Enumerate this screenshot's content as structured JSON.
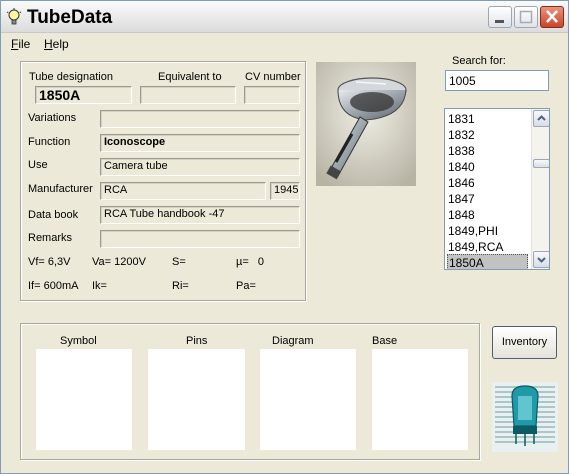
{
  "app": {
    "title": "TubeData"
  },
  "window_controls": {
    "minimize": "minimize",
    "maximize": "maximize",
    "close": "close"
  },
  "menu": [
    {
      "label": "File"
    },
    {
      "label": "Help"
    }
  ],
  "details": {
    "tube_designation_label": "Tube designation",
    "tube_designation": "1850A",
    "equivalent_label": "Equivalent to",
    "equivalent": "",
    "cv_label": "CV number",
    "cv": "",
    "variations_label": "Variations",
    "variations": "",
    "function_label": "Function",
    "function": "Iconoscope",
    "use_label": "Use",
    "use": "Camera tube",
    "manufacturer_label": "Manufacturer",
    "manufacturer": "RCA",
    "year": "1945",
    "databook_label": "Data book",
    "databook": "RCA Tube handbook -47",
    "remarks_label": "Remarks",
    "remarks": "",
    "params": {
      "vf": "Vf= 6,3V",
      "va": "Va= 1200V",
      "s": "S=",
      "mu": "µ=   0",
      "if": "If= 600mA",
      "ik": "Ik=",
      "ri": "Ri=",
      "pa": "Pa="
    }
  },
  "search": {
    "label": "Search for:",
    "value": "1005"
  },
  "list": {
    "items": [
      "1831",
      "1832",
      "1838",
      "1840",
      "1846",
      "1847",
      "1848",
      "1849,PHI",
      "1849,RCA",
      "1850A"
    ],
    "selected": "1850A"
  },
  "panels": {
    "symbol": "Symbol",
    "pins": "Pins",
    "diagram": "Diagram",
    "base": "Base"
  },
  "inventory_button": "Inventory",
  "colors": {
    "window_bg": "#ece9d8",
    "close_red": "#c8452a",
    "list_selected": "#c2c2c2"
  }
}
